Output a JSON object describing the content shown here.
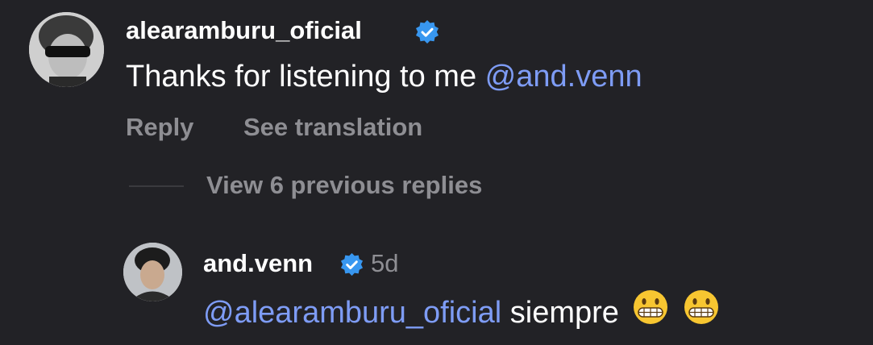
{
  "comment": {
    "username": "alearamburu_oficial",
    "verified_icon": "verified-badge-icon",
    "text": "Thanks for listening to me",
    "mention": "@and.venn",
    "actions": {
      "reply": "Reply",
      "see_translation": "See translation"
    }
  },
  "view_replies": "View 6 previous replies",
  "reply": {
    "username": "and.venn",
    "verified_icon": "verified-badge-icon",
    "time": "5d",
    "mention": "@alearamburu_oficial",
    "text": "siempre",
    "emojis": [
      "grimacing-face-emoji",
      "grimacing-face-emoji"
    ]
  },
  "colors": {
    "background": "#222226",
    "mention": "#7e9cf5",
    "secondary": "#8e8e93",
    "verified": "#3897f0"
  }
}
